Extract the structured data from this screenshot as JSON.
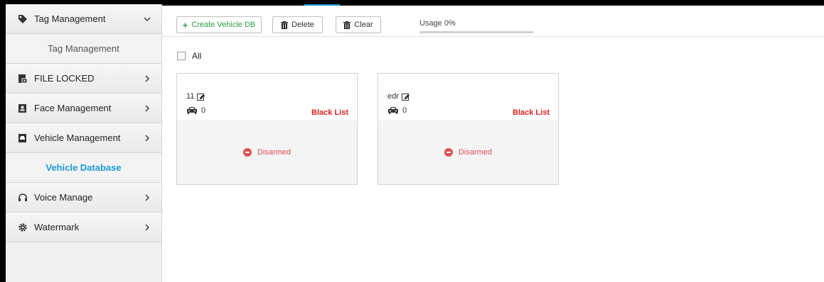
{
  "sidebar": {
    "items": [
      {
        "label": "Tag Management",
        "icon": "tag-icon",
        "chevron": "down"
      },
      {
        "label": "Tag Management",
        "sub": true
      },
      {
        "label": "FILE LOCKED",
        "icon": "file-lock-icon",
        "chevron": "right"
      },
      {
        "label": "Face Management",
        "icon": "face-icon",
        "chevron": "right"
      },
      {
        "label": "Vehicle Management",
        "icon": "vehicle-icon",
        "chevron": "right"
      },
      {
        "label": "Vehicle Database",
        "sub": true,
        "active": true
      },
      {
        "label": "Voice Manage",
        "icon": "headphones-icon",
        "chevron": "right"
      },
      {
        "label": "Watermark",
        "icon": "gear-icon",
        "chevron": "right"
      }
    ]
  },
  "toolbar": {
    "create_label": "Create Vehicle DB",
    "delete_label": "Delete",
    "clear_label": "Clear",
    "usage_label": "Usage 0%",
    "usage_fraction": 0
  },
  "select_all_label": "All",
  "cards": [
    {
      "name": "11",
      "count": "0",
      "list": "Black List",
      "status": "Disarmed"
    },
    {
      "name": "edr",
      "count": "0",
      "list": "Black List",
      "status": "Disarmed"
    }
  ],
  "colors": {
    "accent": "#1a9bd7",
    "create": "#2ea043",
    "black_list": "#e02020",
    "disarmed": "#e05050"
  }
}
